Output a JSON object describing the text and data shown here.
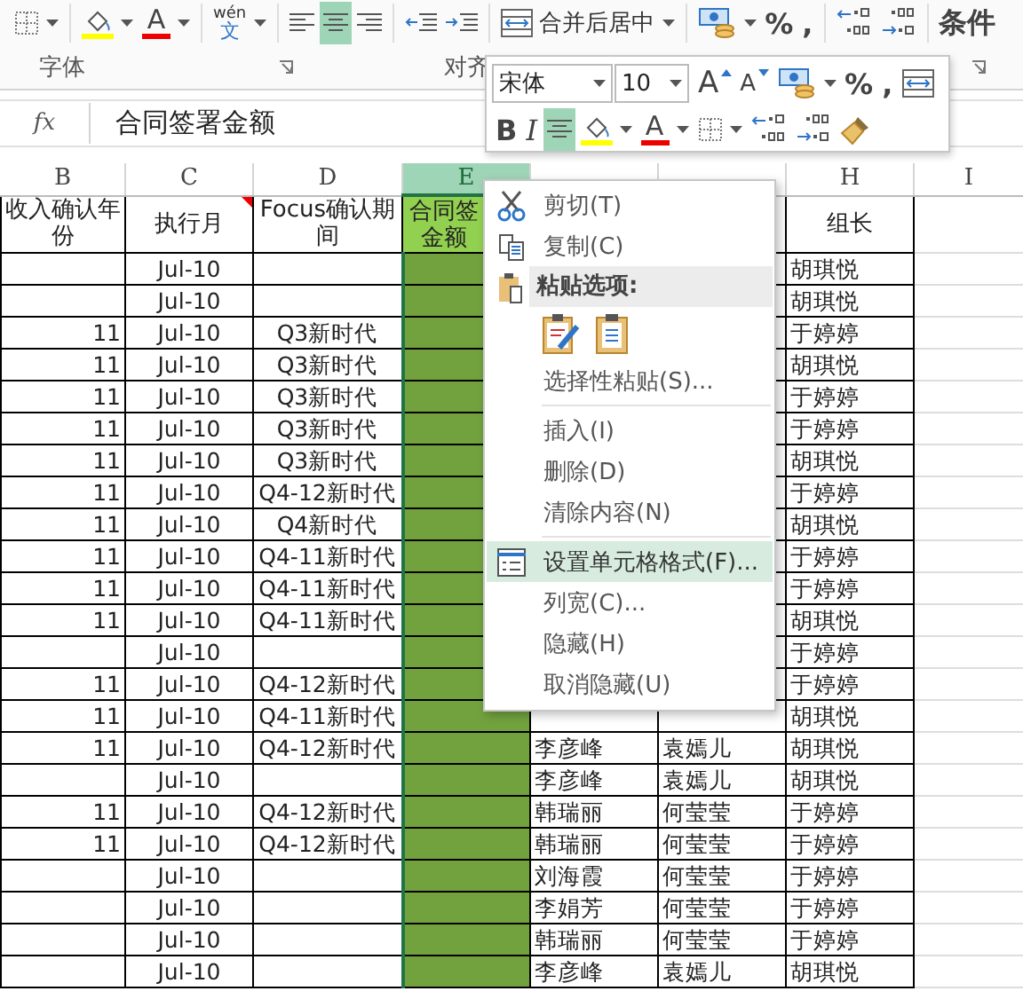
{
  "ribbon": {
    "tool_groups": [
      [
        {
          "kind": "borders",
          "caret": true
        }
      ],
      [
        {
          "kind": "fill-color",
          "caret": true
        },
        {
          "kind": "font-color",
          "label": "A",
          "caret": true
        }
      ],
      [
        {
          "kind": "phonetic",
          "label": "wén",
          "glyph": "文",
          "caret": true
        }
      ],
      [
        {
          "kind": "align-left",
          "selected": false
        },
        {
          "kind": "align-center",
          "selected": true
        },
        {
          "kind": "align-right",
          "selected": false
        }
      ],
      [
        {
          "kind": "outdent"
        },
        {
          "kind": "indent"
        }
      ],
      [
        {
          "kind": "merge",
          "label": "合并后居中",
          "caret": true
        }
      ],
      [
        {
          "kind": "currency",
          "caret": true
        },
        {
          "kind": "text",
          "label": "%"
        },
        {
          "kind": "text",
          "label": ","
        }
      ],
      [
        {
          "kind": "inc-decimal"
        },
        {
          "kind": "dec-decimal"
        }
      ],
      [
        {
          "kind": "text",
          "label": "条件"
        }
      ]
    ],
    "group_labels": [
      {
        "label": "字体"
      },
      {
        "label": "对齐"
      }
    ]
  },
  "formula_bar": {
    "function_label": "fx",
    "value": "合同签署金额"
  },
  "mini_toolbar": {
    "font": "宋体",
    "size": "10",
    "row1": [
      {
        "kind": "font-grow",
        "label": "A"
      },
      {
        "kind": "font-shrink",
        "label": "A"
      },
      {
        "kind": "currency",
        "caret": true
      },
      {
        "kind": "text",
        "label": "%"
      },
      {
        "kind": "text",
        "label": ","
      },
      {
        "kind": "merge"
      }
    ],
    "row2": [
      {
        "kind": "bold",
        "label": "B"
      },
      {
        "kind": "italic",
        "label": "I"
      },
      {
        "kind": "align-center",
        "selected": true
      },
      {
        "kind": "fill-color",
        "caret": true
      },
      {
        "kind": "font-color",
        "label": "A",
        "caret": true
      },
      {
        "kind": "borders",
        "caret": true
      },
      {
        "kind": "inc-decimal"
      },
      {
        "kind": "dec-decimal"
      },
      {
        "kind": "format-painter"
      }
    ]
  },
  "columns": [
    {
      "label": "B",
      "selected": false
    },
    {
      "label": "C",
      "selected": false
    },
    {
      "label": "D",
      "selected": false
    },
    {
      "label": "E",
      "selected": true,
      "color": "#92d050"
    },
    {
      "selected": false
    },
    {
      "selected": false
    },
    {
      "label": "H",
      "selected": false
    },
    {
      "label": "I",
      "selected": false
    }
  ],
  "header_row": {
    "B": {
      "text": "收入确认年份"
    },
    "C": {
      "text": "执行月",
      "comment": true
    },
    "D": {
      "text": "Focus确认期间"
    },
    "E": {
      "text": "合同签金额"
    },
    "H": {
      "text": "组长"
    }
  },
  "rows": [
    {
      "C": "Jul-10",
      "H": "胡琪悦"
    },
    {
      "C": "Jul-10",
      "H": "胡琪悦"
    },
    {
      "B": "11",
      "C": "Jul-10",
      "D": "Q3新时代",
      "H": "于婷婷"
    },
    {
      "B": "11",
      "C": "Jul-10",
      "D": "Q3新时代",
      "H": "胡琪悦"
    },
    {
      "B": "11",
      "C": "Jul-10",
      "D": "Q3新时代",
      "H": "于婷婷"
    },
    {
      "B": "11",
      "C": "Jul-10",
      "D": "Q3新时代",
      "H": "于婷婷"
    },
    {
      "B": "11",
      "C": "Jul-10",
      "D": "Q3新时代",
      "H": "胡琪悦"
    },
    {
      "B": "11",
      "C": "Jul-10",
      "D": "Q4-12新时代",
      "H": "于婷婷"
    },
    {
      "B": "11",
      "C": "Jul-10",
      "D": "Q4新时代",
      "H": "胡琪悦"
    },
    {
      "B": "11",
      "C": "Jul-10",
      "D": "Q4-11新时代",
      "H": "于婷婷"
    },
    {
      "B": "11",
      "C": "Jul-10",
      "D": "Q4-11新时代",
      "H": "于婷婷"
    },
    {
      "B": "11",
      "C": "Jul-10",
      "D": "Q4-11新时代",
      "H": "胡琪悦"
    },
    {
      "C": "Jul-10",
      "H": "于婷婷"
    },
    {
      "B": "11",
      "C": "Jul-10",
      "D": "Q4-12新时代",
      "H": "于婷婷"
    },
    {
      "B": "11",
      "C": "Jul-10",
      "D": "Q4-11新时代",
      "H": "胡琪悦"
    },
    {
      "B": "11",
      "C": "Jul-10",
      "D": "Q4-12新时代",
      "F": "李彦峰",
      "G": "袁嫣儿",
      "H": "胡琪悦"
    },
    {
      "C": "Jul-10",
      "F": "李彦峰",
      "G": "袁嫣儿",
      "H": "胡琪悦"
    },
    {
      "B": "11",
      "C": "Jul-10",
      "D": "Q4-12新时代",
      "F": "韩瑞丽",
      "G": "何莹莹",
      "H": "于婷婷"
    },
    {
      "B": "11",
      "C": "Jul-10",
      "D": "Q4-12新时代",
      "F": "韩瑞丽",
      "G": "何莹莹",
      "H": "于婷婷"
    },
    {
      "C": "Jul-10",
      "F": "刘海霞",
      "G": "何莹莹",
      "H": "于婷婷"
    },
    {
      "C": "Jul-10",
      "F": "李娟芳",
      "G": "何莹莹",
      "H": "于婷婷"
    },
    {
      "C": "Jul-10",
      "F": "韩瑞丽",
      "G": "何莹莹",
      "H": "于婷婷"
    },
    {
      "C": "Jul-10",
      "F": "李彦峰",
      "G": "袁嫣儿",
      "H": "胡琪悦"
    }
  ],
  "context_menu": [
    {
      "kind": "cut",
      "label": "剪切(T)",
      "selected": false
    },
    {
      "kind": "copy",
      "label": "复制(C)",
      "selected": false
    },
    {
      "kind": "paste-header",
      "label": "粘贴选项:"
    },
    {
      "kind": "paste-icons"
    },
    {
      "kind": "item",
      "label": "选择性粘贴(S)...",
      "selected": false
    },
    {
      "kind": "separator"
    },
    {
      "kind": "item",
      "label": "插入(I)",
      "selected": false
    },
    {
      "kind": "item",
      "label": "删除(D)",
      "selected": false
    },
    {
      "kind": "item",
      "label": "清除内容(N)",
      "selected": false
    },
    {
      "kind": "separator"
    },
    {
      "kind": "format-cells",
      "label": "设置单元格格式(F)...",
      "selected": true
    },
    {
      "kind": "item",
      "label": "列宽(C)...",
      "selected": false
    },
    {
      "kind": "item",
      "label": "隐藏(H)",
      "selected": false
    },
    {
      "kind": "item",
      "label": "取消隐藏(U)",
      "selected": false
    }
  ]
}
